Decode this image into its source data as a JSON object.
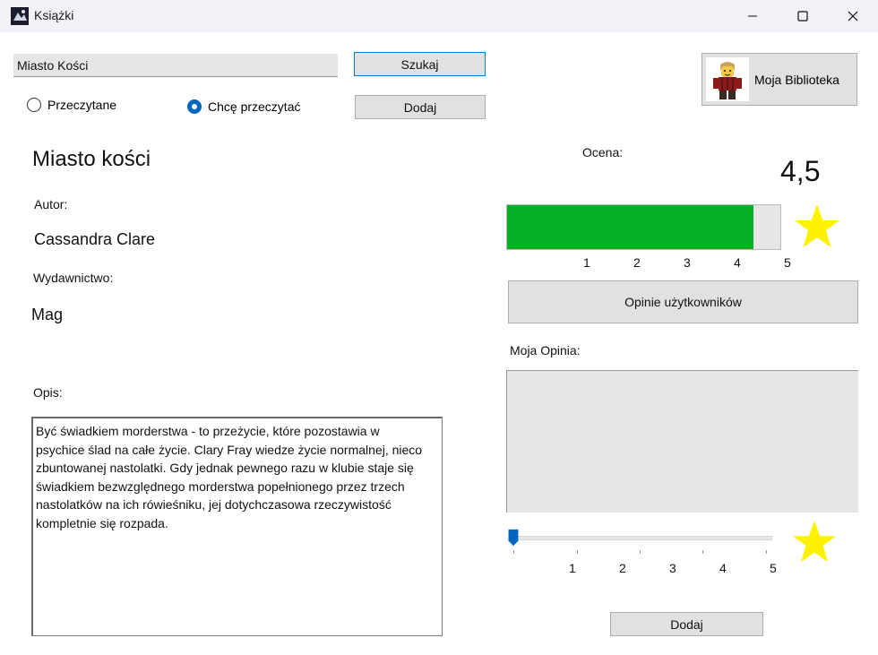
{
  "window": {
    "title": "Książki"
  },
  "search": {
    "value": "Miasto Kości",
    "button": "Szukaj"
  },
  "status": {
    "read_label": "Przeczytane",
    "want_label": "Chcę przeczytać",
    "selected": "Chcę przeczytać",
    "add_button": "Dodaj"
  },
  "library_button": {
    "label": "Moja Biblioteka"
  },
  "book": {
    "title": "Miasto kości",
    "author_label": "Autor:",
    "author": "Cassandra Clare",
    "publisher_label": "Wydawnictwo:",
    "publisher": "Mag",
    "description_label": "Opis:",
    "description_lines": [
      "Być świadkiem morderstwa - to przeżycie, które pozostawia w",
      "psychice ślad na całe życie. Clary Fray wiedze życie normalnej, nieco",
      "zbuntowanej nastolatki. Gdy jednak pewnego razu w klubie staje się",
      "świadkiem bezwzględnego morderstwa popełnionego przez trzech",
      "nastolatków na ich rówieśniku, jej dotychczasowa rzeczywistość",
      "kompletnie się rozpada."
    ]
  },
  "rating": {
    "label": "Ocena:",
    "value_text": "4,5",
    "value": 4.5,
    "max": 5,
    "fill_fraction": 0.9,
    "scale": [
      "1",
      "2",
      "3",
      "4",
      "5"
    ],
    "bar_color": "#06b025",
    "star_color": "#fff200",
    "reviews_button": "Opinie użytkowników"
  },
  "my_opinion": {
    "label": "Moja Opinia:",
    "text": "",
    "slider_value": 0,
    "scale": [
      "1",
      "2",
      "3",
      "4",
      "5"
    ],
    "add_button": "Dodaj",
    "accent": "#0067c0"
  }
}
